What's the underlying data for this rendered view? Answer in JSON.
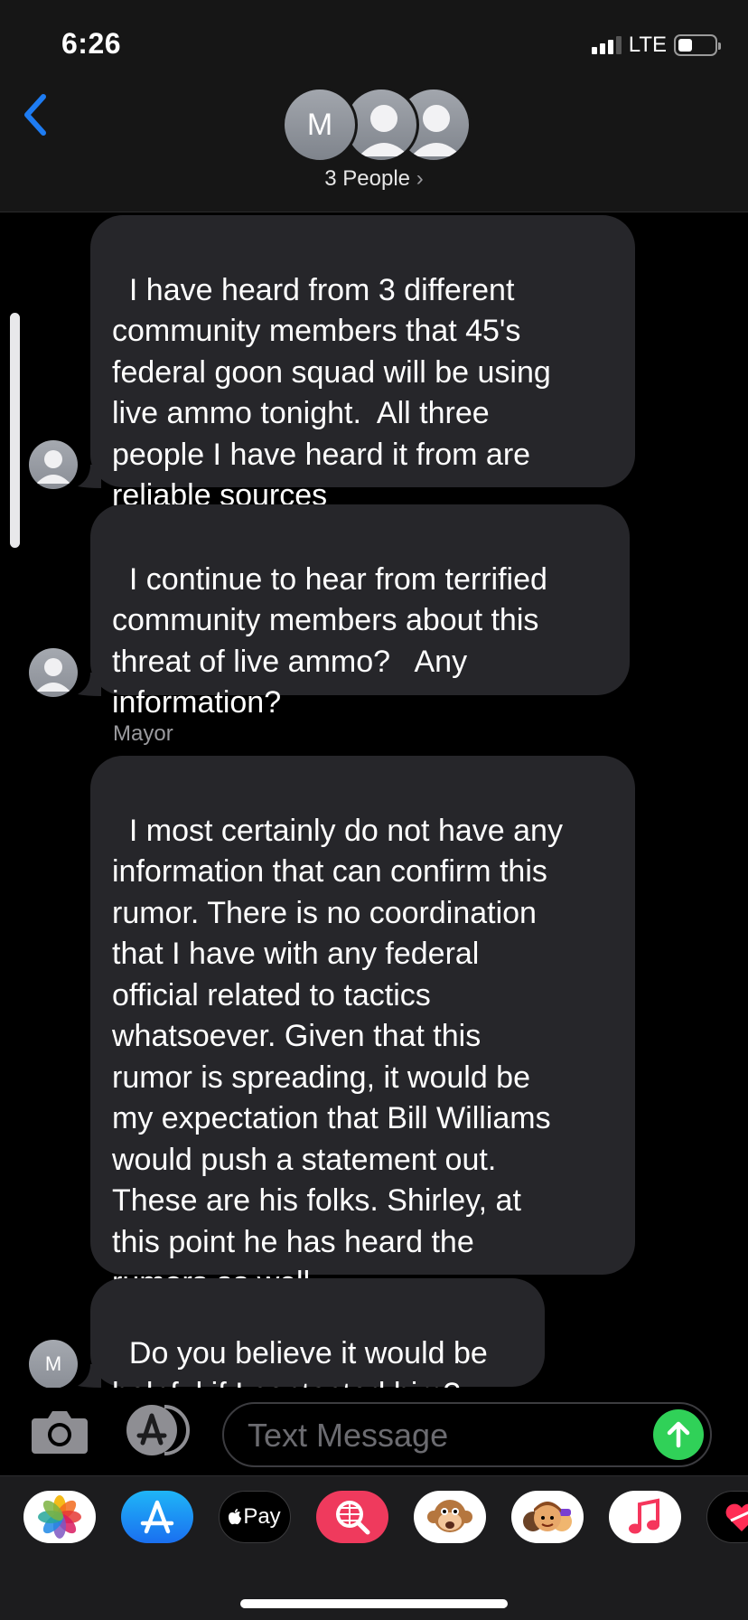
{
  "status_bar": {
    "time": "6:26",
    "network": "LTE"
  },
  "header": {
    "back_icon": "chevron-left-icon",
    "avatar_initial": "M",
    "participants": "3 People",
    "chevron": "›"
  },
  "messages": [
    {
      "text": "I have heard from 3 different\ncommunity members that 45's\nfederal goon squad will be using\nlive ammo tonight.  All three\npeople I have heard it from are\nreliable sources"
    },
    {
      "text": "I continue to hear from terrified\ncommunity members about this\nthreat of live ammo?   Any\ninformation?"
    },
    {
      "sender": "Mayor",
      "text": "I most certainly do not have any\ninformation that can confirm this\nrumor. There is no coordination\nthat I have with any federal\nofficial related to tactics\nwhatsoever. Given that this\nrumor is spreading, it would be\nmy expectation that Bill Williams\nwould push a statement out.\nThese are his folks. Shirley, at\nthis point he has heard the\nrumors as well."
    },
    {
      "text": "Do you believe it would be\nhelpful if I contacted him?",
      "avatar_initial": "M"
    }
  ],
  "compose": {
    "placeholder": "Text Message",
    "camera_icon": "camera-icon",
    "apps_icon": "app-store-icon",
    "send_icon": "send-arrow-icon"
  },
  "app_drawer": {
    "apps": [
      "photos-icon",
      "app-store-icon",
      "apple-pay-icon",
      "web-search-icon",
      "animoji-icon",
      "memoji-icon",
      "music-icon",
      "heart-sticker-icon"
    ],
    "apple_pay_label": "Pay"
  },
  "colors": {
    "bubble": "#26262a",
    "accent_blue": "#1e7cf2",
    "send_green": "#30d158"
  }
}
